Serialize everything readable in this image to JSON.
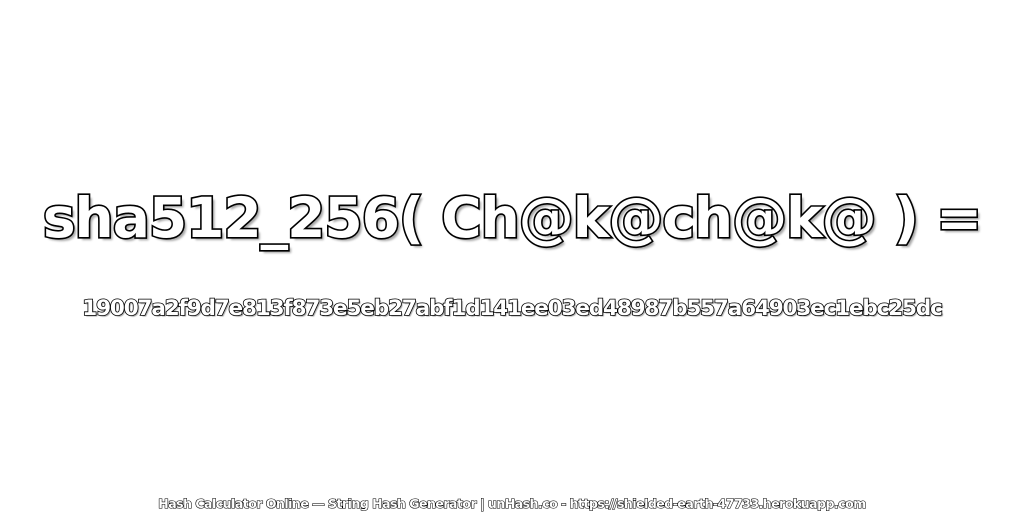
{
  "main": {
    "expression": "sha512_256( Ch@k@ch@k@ ) =",
    "hash": "19007a2f9d7e813f873e5eb27abf1d141ee03ed48987b557a64903ec1ebc25dc"
  },
  "footer": {
    "text": "Hash Calculator Online — String Hash Generator | unHash.co - https://shielded-earth-47733.herokuapp.com"
  },
  "colors": {
    "background": "#ffffff",
    "text_fill": "#ffffff",
    "text_outline": "#000000"
  }
}
